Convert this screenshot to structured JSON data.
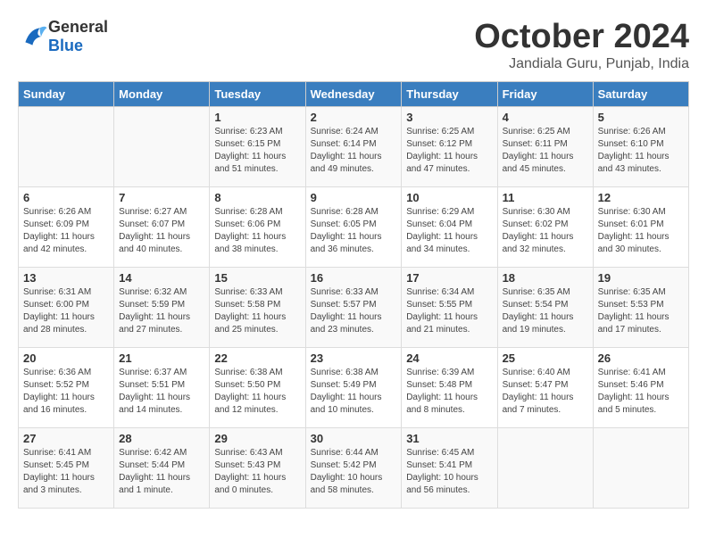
{
  "header": {
    "logo_general": "General",
    "logo_blue": "Blue",
    "month_title": "October 2024",
    "subtitle": "Jandiala Guru, Punjab, India"
  },
  "days_of_week": [
    "Sunday",
    "Monday",
    "Tuesday",
    "Wednesday",
    "Thursday",
    "Friday",
    "Saturday"
  ],
  "weeks": [
    [
      {
        "day": "",
        "info": ""
      },
      {
        "day": "",
        "info": ""
      },
      {
        "day": "1",
        "info": "Sunrise: 6:23 AM\nSunset: 6:15 PM\nDaylight: 11 hours and 51 minutes."
      },
      {
        "day": "2",
        "info": "Sunrise: 6:24 AM\nSunset: 6:14 PM\nDaylight: 11 hours and 49 minutes."
      },
      {
        "day": "3",
        "info": "Sunrise: 6:25 AM\nSunset: 6:12 PM\nDaylight: 11 hours and 47 minutes."
      },
      {
        "day": "4",
        "info": "Sunrise: 6:25 AM\nSunset: 6:11 PM\nDaylight: 11 hours and 45 minutes."
      },
      {
        "day": "5",
        "info": "Sunrise: 6:26 AM\nSunset: 6:10 PM\nDaylight: 11 hours and 43 minutes."
      }
    ],
    [
      {
        "day": "6",
        "info": "Sunrise: 6:26 AM\nSunset: 6:09 PM\nDaylight: 11 hours and 42 minutes."
      },
      {
        "day": "7",
        "info": "Sunrise: 6:27 AM\nSunset: 6:07 PM\nDaylight: 11 hours and 40 minutes."
      },
      {
        "day": "8",
        "info": "Sunrise: 6:28 AM\nSunset: 6:06 PM\nDaylight: 11 hours and 38 minutes."
      },
      {
        "day": "9",
        "info": "Sunrise: 6:28 AM\nSunset: 6:05 PM\nDaylight: 11 hours and 36 minutes."
      },
      {
        "day": "10",
        "info": "Sunrise: 6:29 AM\nSunset: 6:04 PM\nDaylight: 11 hours and 34 minutes."
      },
      {
        "day": "11",
        "info": "Sunrise: 6:30 AM\nSunset: 6:02 PM\nDaylight: 11 hours and 32 minutes."
      },
      {
        "day": "12",
        "info": "Sunrise: 6:30 AM\nSunset: 6:01 PM\nDaylight: 11 hours and 30 minutes."
      }
    ],
    [
      {
        "day": "13",
        "info": "Sunrise: 6:31 AM\nSunset: 6:00 PM\nDaylight: 11 hours and 28 minutes."
      },
      {
        "day": "14",
        "info": "Sunrise: 6:32 AM\nSunset: 5:59 PM\nDaylight: 11 hours and 27 minutes."
      },
      {
        "day": "15",
        "info": "Sunrise: 6:33 AM\nSunset: 5:58 PM\nDaylight: 11 hours and 25 minutes."
      },
      {
        "day": "16",
        "info": "Sunrise: 6:33 AM\nSunset: 5:57 PM\nDaylight: 11 hours and 23 minutes."
      },
      {
        "day": "17",
        "info": "Sunrise: 6:34 AM\nSunset: 5:55 PM\nDaylight: 11 hours and 21 minutes."
      },
      {
        "day": "18",
        "info": "Sunrise: 6:35 AM\nSunset: 5:54 PM\nDaylight: 11 hours and 19 minutes."
      },
      {
        "day": "19",
        "info": "Sunrise: 6:35 AM\nSunset: 5:53 PM\nDaylight: 11 hours and 17 minutes."
      }
    ],
    [
      {
        "day": "20",
        "info": "Sunrise: 6:36 AM\nSunset: 5:52 PM\nDaylight: 11 hours and 16 minutes."
      },
      {
        "day": "21",
        "info": "Sunrise: 6:37 AM\nSunset: 5:51 PM\nDaylight: 11 hours and 14 minutes."
      },
      {
        "day": "22",
        "info": "Sunrise: 6:38 AM\nSunset: 5:50 PM\nDaylight: 11 hours and 12 minutes."
      },
      {
        "day": "23",
        "info": "Sunrise: 6:38 AM\nSunset: 5:49 PM\nDaylight: 11 hours and 10 minutes."
      },
      {
        "day": "24",
        "info": "Sunrise: 6:39 AM\nSunset: 5:48 PM\nDaylight: 11 hours and 8 minutes."
      },
      {
        "day": "25",
        "info": "Sunrise: 6:40 AM\nSunset: 5:47 PM\nDaylight: 11 hours and 7 minutes."
      },
      {
        "day": "26",
        "info": "Sunrise: 6:41 AM\nSunset: 5:46 PM\nDaylight: 11 hours and 5 minutes."
      }
    ],
    [
      {
        "day": "27",
        "info": "Sunrise: 6:41 AM\nSunset: 5:45 PM\nDaylight: 11 hours and 3 minutes."
      },
      {
        "day": "28",
        "info": "Sunrise: 6:42 AM\nSunset: 5:44 PM\nDaylight: 11 hours and 1 minute."
      },
      {
        "day": "29",
        "info": "Sunrise: 6:43 AM\nSunset: 5:43 PM\nDaylight: 11 hours and 0 minutes."
      },
      {
        "day": "30",
        "info": "Sunrise: 6:44 AM\nSunset: 5:42 PM\nDaylight: 10 hours and 58 minutes."
      },
      {
        "day": "31",
        "info": "Sunrise: 6:45 AM\nSunset: 5:41 PM\nDaylight: 10 hours and 56 minutes."
      },
      {
        "day": "",
        "info": ""
      },
      {
        "day": "",
        "info": ""
      }
    ]
  ]
}
